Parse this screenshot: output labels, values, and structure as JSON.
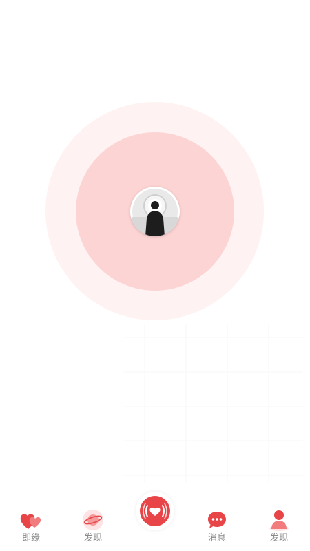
{
  "colors": {
    "accent": "#e84548",
    "ring_outer": "#fef2f2",
    "ring_inner": "#fdd4d4",
    "tab_label": "#8a8a8a"
  },
  "radar": {
    "avatar_icon": "user-avatar-photo"
  },
  "tabbar": {
    "items": [
      {
        "label": "即缘",
        "icon": "hearts-icon"
      },
      {
        "label": "发现",
        "icon": "planet-icon"
      },
      {
        "label": "",
        "icon": "heart-broadcast-icon"
      },
      {
        "label": "消息",
        "icon": "chat-bubble-icon"
      },
      {
        "label": "发现",
        "icon": "person-icon"
      }
    ]
  }
}
